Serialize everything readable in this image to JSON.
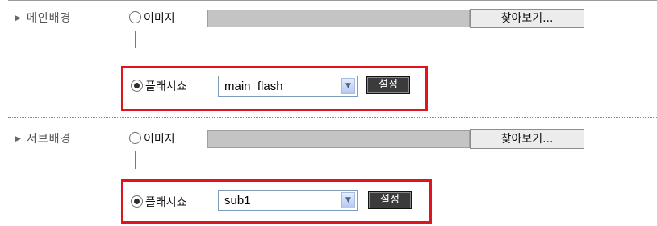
{
  "main": {
    "label": "메인배경",
    "image_option": {
      "label": "이미지",
      "selected": false
    },
    "browse_label": "찾아보기...",
    "flash_option": {
      "label": "플래시쇼",
      "selected": true
    },
    "flash_select": {
      "value": "main_flash"
    },
    "set_label": "설정"
  },
  "sub": {
    "label": "서브배경",
    "image_option": {
      "label": "이미지",
      "selected": false
    },
    "browse_label": "찾아보기...",
    "flash_option": {
      "label": "플래시쇼",
      "selected": true
    },
    "flash_select": {
      "value": "sub1"
    },
    "set_label": "설정"
  },
  "colors": {
    "highlight": "#e0141e",
    "field_gray": "#c4c4c4",
    "set_button": "#3b3b3b"
  }
}
